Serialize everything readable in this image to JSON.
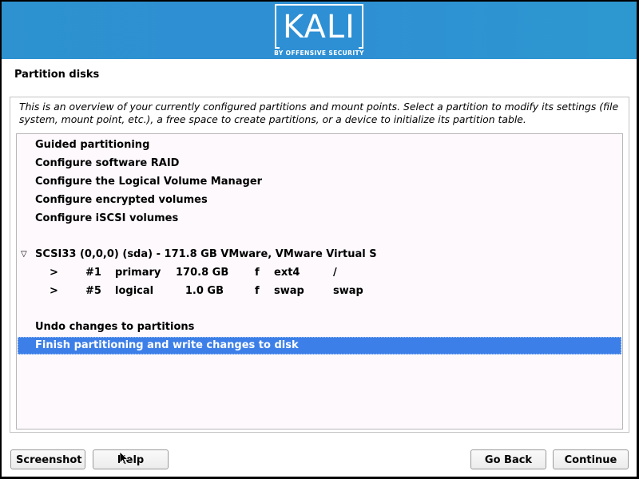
{
  "banner": {
    "logo_text": "KALI",
    "logo_subtitle": "BY OFFENSIVE SECURITY",
    "colors": {
      "banner_blue": "#2e8fd4",
      "selection_blue": "#3c7fe8"
    }
  },
  "page": {
    "title": "Partition disks",
    "intro": "This is an overview of your currently configured partitions and mount points. Select a partition to modify its settings (file system, mount point, etc.), a free space to create partitions, or a device to initialize its partition table."
  },
  "menu": {
    "items": [
      {
        "label": "Guided partitioning"
      },
      {
        "label": "Configure software RAID"
      },
      {
        "label": "Configure the Logical Volume Manager"
      },
      {
        "label": "Configure encrypted volumes"
      },
      {
        "label": "Configure iSCSI volumes"
      }
    ],
    "disk": {
      "expander_icon": "triangle-down",
      "label": "SCSI33 (0,0,0) (sda) - 171.8 GB VMware, VMware Virtual S",
      "partitions": [
        {
          "marker": ">",
          "number": "#1",
          "type": "primary",
          "size": "170.8 GB",
          "flag": "f",
          "fs": "ext4",
          "mount": "/"
        },
        {
          "marker": ">",
          "number": "#5",
          "type": "logical",
          "size": "1.0 GB",
          "flag": "f",
          "fs": "swap",
          "mount": "swap"
        }
      ]
    },
    "actions": [
      {
        "label": "Undo changes to partitions",
        "selected": false
      },
      {
        "label": "Finish partitioning and write changes to disk",
        "selected": true
      }
    ]
  },
  "buttons": {
    "screenshot": "Screenshot",
    "help": "Help",
    "go_back": "Go Back",
    "continue": "Continue"
  }
}
